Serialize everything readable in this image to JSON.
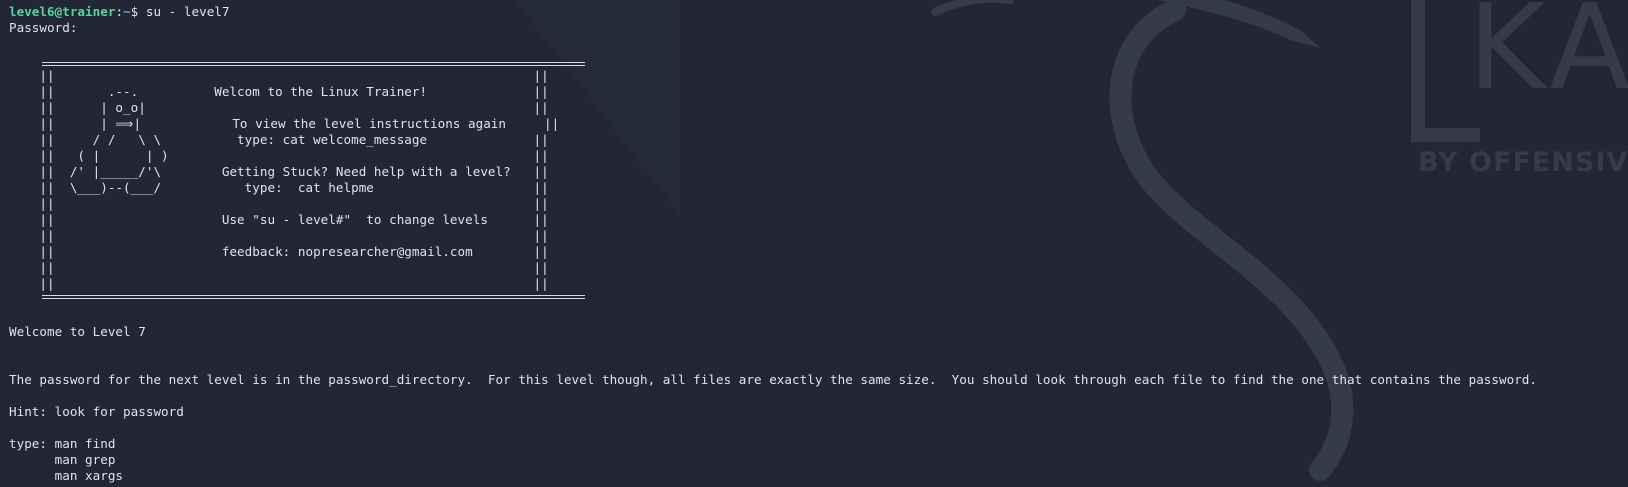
{
  "terminal": {
    "prompt": {
      "user_host": "level6@trainer",
      "path": "~",
      "symbol": "$ ",
      "command": "su - level7"
    },
    "password_prompt": "Password:",
    "banner": {
      "lines": [
        "    ||                                                               ||",
        "    ||       .--.          Welcom to the Linux Trainer!              ||",
        "    ||      | o_o|                                                   ||",
        "    ||      | ⟹|            To view the level instructions again     ||",
        "    ||     / /   \\ \\          type: cat welcome_message              ||",
        "    ||   ( |      | )                                                ||",
        "    ||  /' |_____/'\\        Getting Stuck? Need help with a level?   ||",
        "    ||  \\___)--(___/           type:  cat helpme                     ||",
        "    ||                                                               ||",
        "    ||                      Use \"su - level#\"  to change levels      ||",
        "    ||                                                               ||",
        "    ||                      feedback: nopresearcher@gmail.com        ||",
        "    ||                                                               ||",
        "    ||                                                               ||"
      ]
    },
    "welcome": "Welcome to Level 7",
    "description": "The password for the next level is in the password_directory.  For this level though, all files are exactly the same size.  You should look through each file to find the one that contains the password.",
    "hint": "Hint: look for password",
    "type_lines": [
      "type: man find",
      "      man grep",
      "      man xargs"
    ]
  },
  "wallpaper": {
    "brand_letters": "KA",
    "brand_tagline": "BY OFFENSIVE",
    "colors": {
      "background": "#232735",
      "logo": "#3a3f4f"
    }
  }
}
